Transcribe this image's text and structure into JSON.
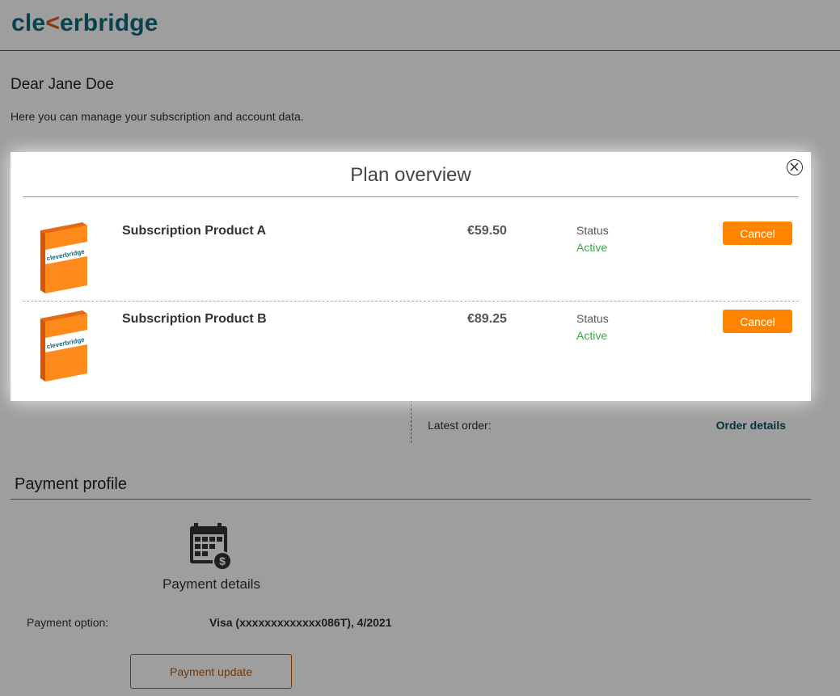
{
  "brand": {
    "logo_before": "cle",
    "logo_arrow": "<",
    "logo_after": "erbridge",
    "primary_color": "#0e6b7e",
    "accent_color": "#ff8400"
  },
  "page": {
    "greeting": "Dear Jane Doe",
    "intro": "Here you can manage your subscription and account data."
  },
  "subscription_info": {
    "latest_order_label": "Latest order:",
    "order_details_link": "Order details"
  },
  "payment_profile": {
    "title": "Payment profile",
    "details_label": "Payment details",
    "option_label": "Payment option:",
    "option_value": "Visa (xxxxxxxxxxxxx086T), 4/2021",
    "update_button": "Payment update"
  },
  "modal": {
    "title": "Plan overview",
    "close_icon": "close-circle-icon",
    "plans": [
      {
        "name": "Subscription Product A",
        "price": "€59.50",
        "status_label": "Status",
        "status_value": "Active",
        "cancel_label": "Cancel"
      },
      {
        "name": "Subscription Product B",
        "price": "€89.25",
        "status_label": "Status",
        "status_value": "Active",
        "cancel_label": "Cancel"
      }
    ]
  }
}
